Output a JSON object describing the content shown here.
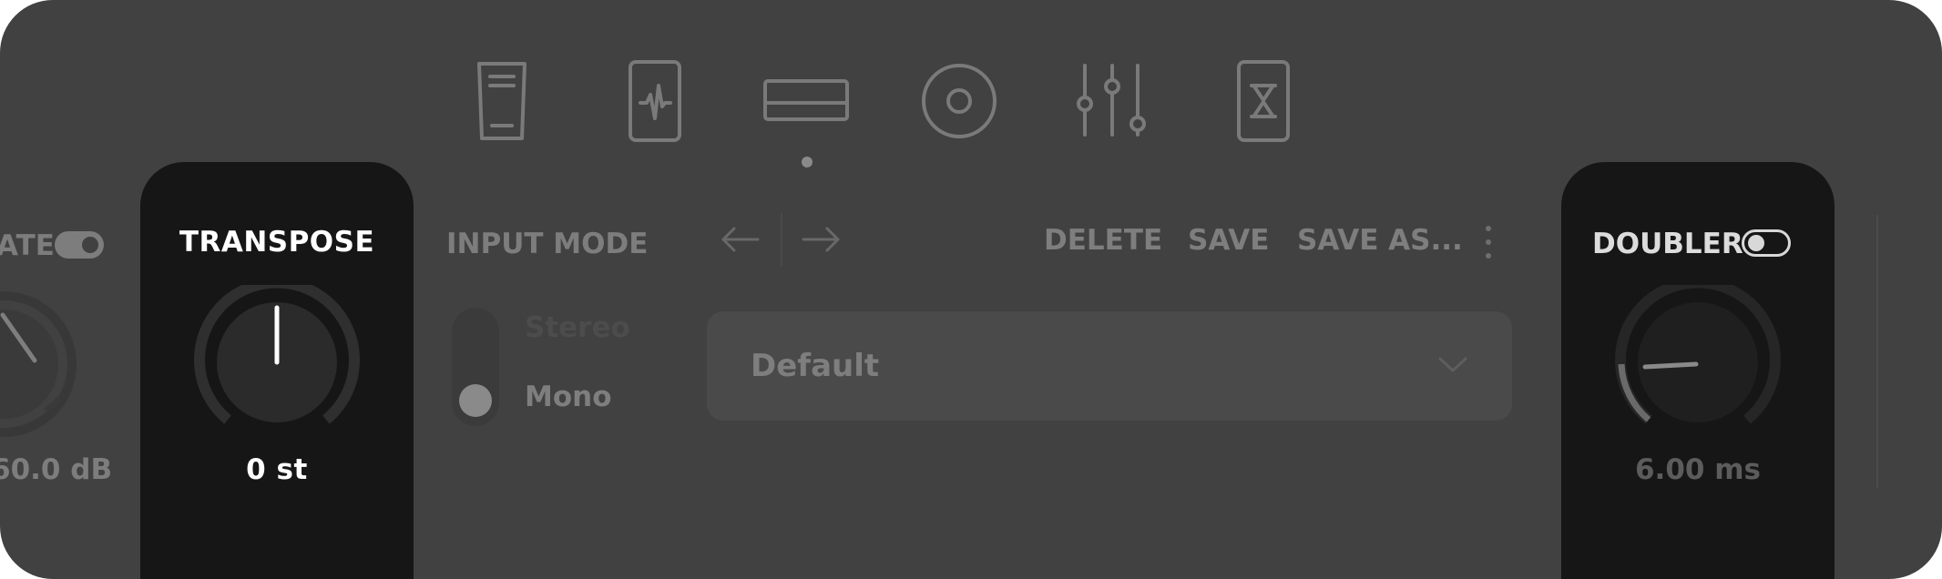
{
  "nav": {
    "icons": [
      "pedal-icon",
      "waveform-card-icon",
      "rack-unit-icon",
      "speaker-icon",
      "mixer-sliders-icon",
      "hourglass-card-icon"
    ],
    "active_index": 2
  },
  "left_partial": {
    "label": "ATE",
    "value": "60.0 dB",
    "toggle_on": true
  },
  "transpose": {
    "label": "TRANSPOSE",
    "value": "0 st"
  },
  "input_mode": {
    "label": "INPUT MODE",
    "options": [
      "Stereo",
      "Mono"
    ],
    "selected": "Mono"
  },
  "preset_toolbar": {
    "delete_label": "DELETE",
    "save_label": "SAVE",
    "save_as_label": "SAVE AS..."
  },
  "preset": {
    "selected": "Default"
  },
  "doubler": {
    "label": "DOUBLER",
    "value": "6.00 ms",
    "toggle_on": false
  },
  "colors": {
    "background": "#414141",
    "panel": "#161616",
    "icon": "#7a7a7a",
    "text_muted": "#7e7e7e",
    "text_active": "#ffffff"
  }
}
